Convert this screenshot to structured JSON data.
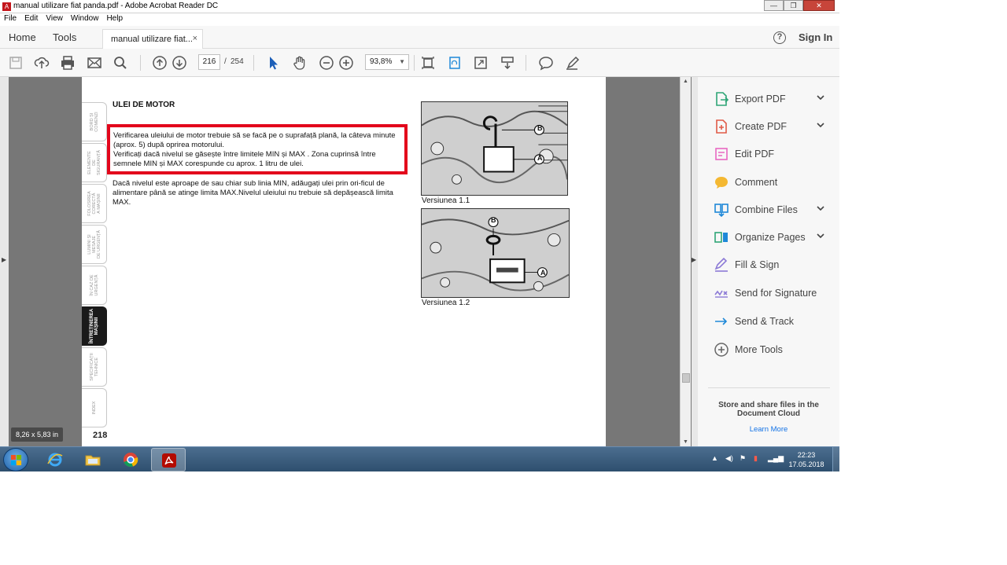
{
  "window": {
    "title": "manual utilizare fiat panda.pdf - Adobe Acrobat Reader DC",
    "minimize": "—",
    "restore": "❐",
    "close": "✕"
  },
  "menu": [
    "File",
    "Edit",
    "View",
    "Window",
    "Help"
  ],
  "tabs": {
    "home": "Home",
    "tools": "Tools",
    "document": "manual utilizare fiat...",
    "close": "×",
    "help": "?",
    "sign_in": "Sign In"
  },
  "toolbar": {
    "page_current": "216",
    "page_separator": "/",
    "page_total": "254",
    "zoom": "93,8%"
  },
  "document": {
    "side_tabs": [
      "BORD ȘI\nCOMENZI",
      "ELEMENTE\nDE\nSIGURANȚĂ",
      "FOLOSIREA\nCORECTĂ\nA MAȘINII",
      "LUMINI ȘI\nMESAJE\nDE URGENȚĂ",
      "ÎN CAZ DE\nURGENȚĂ",
      "ÎNTREȚINEREA\nMAȘINII",
      "SPECIFICAȚII\nTEHNICE",
      "INDEX"
    ],
    "active_tab_index": 5,
    "page_number": "218",
    "section_title": "ULEI DE MOTOR",
    "highlighted_paragraph": "Verificarea uleiului de motor trebuie să se facă pe o suprafață plană, la câteva minute (aprox. 5) după oprirea motorului.\nVerificați dacă nivelul se găsește între limitele MIN și MAX . Zona cuprinsă între semnele MIN și MAX corespunde cu aprox. 1 litru de ulei.",
    "paragraph": "Dacă nivelul este aproape de sau chiar sub linia MIN, adăugați ulei prin ori-ficul de alimentare până se atinge limita MAX.Nivelul uleiului nu trebuie să depășească limita MAX.",
    "figure1_caption": "Versiunea 1.1",
    "figure2_caption": "Versiunea 1.2",
    "label_a": "A",
    "label_b": "B",
    "page_size_tooltip": "8,26 x 5,83 in"
  },
  "right_panel": {
    "tools": [
      {
        "label": "Export PDF",
        "icon": "export-pdf-icon",
        "color": "#2fa577",
        "has_chevron": true
      },
      {
        "label": "Create PDF",
        "icon": "create-pdf-icon",
        "color": "#e05a47",
        "has_chevron": true
      },
      {
        "label": "Edit PDF",
        "icon": "edit-pdf-icon",
        "color": "#e868c2",
        "has_chevron": false
      },
      {
        "label": "Comment",
        "icon": "comment-icon",
        "color": "#f4b832",
        "has_chevron": false
      },
      {
        "label": "Combine Files",
        "icon": "combine-files-icon",
        "color": "#1e88d8",
        "has_chevron": true
      },
      {
        "label": "Organize Pages",
        "icon": "organize-pages-icon",
        "color": "#2fa577",
        "has_chevron": true
      },
      {
        "label": "Fill & Sign",
        "icon": "fill-sign-icon",
        "color": "#8c7ad6",
        "has_chevron": false
      },
      {
        "label": "Send for Signature",
        "icon": "send-signature-icon",
        "color": "#8c7ad6",
        "has_chevron": false
      },
      {
        "label": "Send & Track",
        "icon": "send-track-icon",
        "color": "#1e88d8",
        "has_chevron": false
      },
      {
        "label": "More Tools",
        "icon": "more-tools-icon",
        "color": "#666666",
        "has_chevron": false
      }
    ],
    "cloud_message": "Store and share files in the Document Cloud",
    "learn_more": "Learn More"
  },
  "taskbar": {
    "clock_time": "22:23",
    "clock_date": "17.05.2018"
  },
  "colors": {
    "highlight_box": "#e3061c",
    "link": "#1473e6",
    "doc_background": "#777777"
  }
}
